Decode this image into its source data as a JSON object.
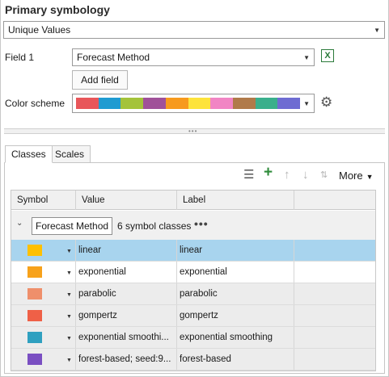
{
  "section_title": "Primary symbology",
  "renderer": {
    "value": "Unique Values"
  },
  "field1": {
    "label": "Field 1",
    "value": "Forecast Method"
  },
  "add_field_label": "Add field",
  "color_scheme": {
    "label": "Color scheme",
    "colors": [
      "#e8565a",
      "#1f9bd1",
      "#a4c33a",
      "#a05199",
      "#f79a1d",
      "#fde33b",
      "#f185c4",
      "#b07a4a",
      "#3aaf8c",
      "#6e6cd2"
    ]
  },
  "tabs": [
    "Classes",
    "Scales"
  ],
  "toolbar": {
    "more_label": "More"
  },
  "table": {
    "headers": [
      "Symbol",
      "Value",
      "Label"
    ],
    "group_field": "Forecast Method",
    "group_count": "6 symbol classes",
    "rows": [
      {
        "color": "#ffc000",
        "value": "linear",
        "label": "linear"
      },
      {
        "color": "#f7a21b",
        "value": "exponential",
        "label": "exponential"
      },
      {
        "color": "#ef8f6b",
        "value": "parabolic",
        "label": "parabolic"
      },
      {
        "color": "#ef6047",
        "value": "gompertz",
        "label": "gompertz"
      },
      {
        "color": "#2fa0c0",
        "value": "exponential smoothi...",
        "label": "exponential smoothing"
      },
      {
        "color": "#7a4fc2",
        "value": "forest-based; seed:9...",
        "label": "forest-based"
      }
    ]
  }
}
